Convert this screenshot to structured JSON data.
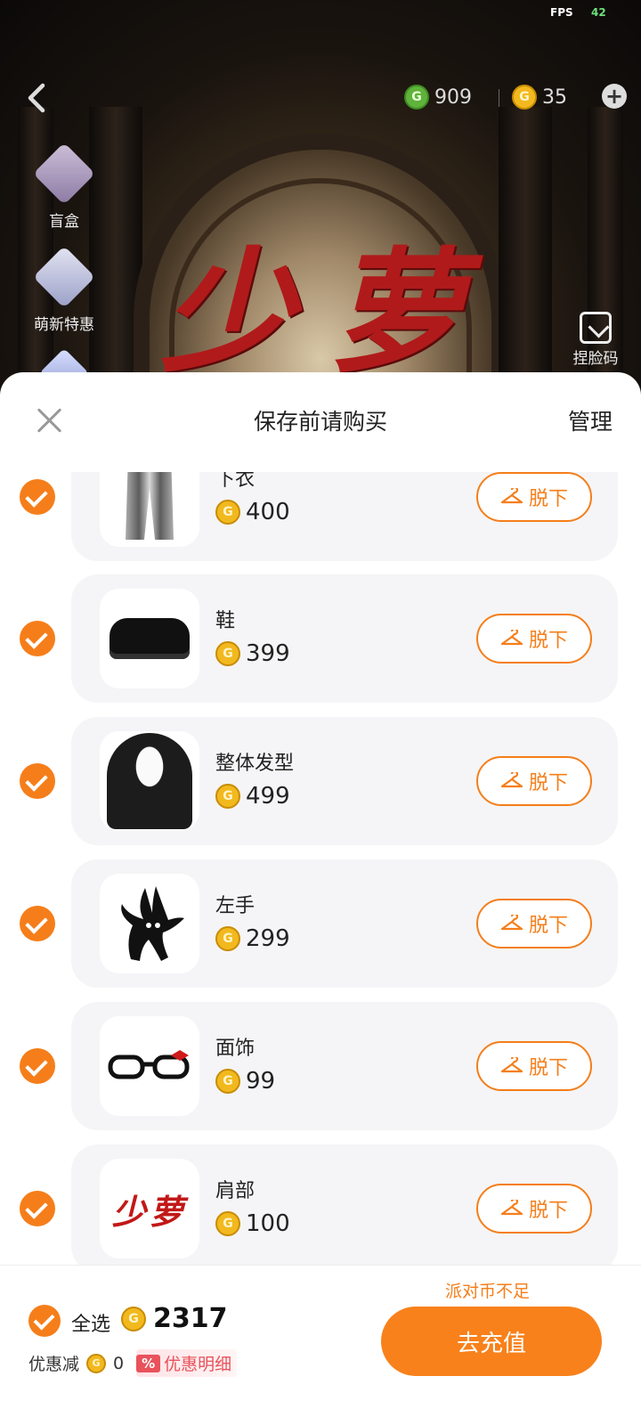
{
  "status_bar": {
    "fps_label": "FPS",
    "fps_value": "42"
  },
  "header": {
    "green_currency": "909",
    "gold_currency": "35"
  },
  "side_menu": [
    {
      "label": "盲盒"
    },
    {
      "label": "萌新特惠"
    }
  ],
  "face_code_label": "捏脸码",
  "scene_brand_text": "少萝",
  "sheet": {
    "title": "保存前请购买",
    "manage_label": "管理"
  },
  "items": [
    {
      "name": "下衣",
      "price": "400",
      "action": "脱下",
      "thumb": "pants-icon",
      "checked": true
    },
    {
      "name": "鞋",
      "price": "399",
      "action": "脱下",
      "thumb": "shoes-icon",
      "checked": true
    },
    {
      "name": "整体发型",
      "price": "499",
      "action": "脱下",
      "thumb": "hairstyle-icon",
      "checked": true
    },
    {
      "name": "左手",
      "price": "299",
      "action": "脱下",
      "thumb": "bunny-plush-icon",
      "checked": true
    },
    {
      "name": "面饰",
      "price": "99",
      "action": "脱下",
      "thumb": "glasses-icon",
      "checked": true
    },
    {
      "name": "肩部",
      "price": "100",
      "action": "脱下",
      "thumb": "shoulder-text-icon",
      "checked": true,
      "thumb_text": "少萝"
    }
  ],
  "footer": {
    "select_all_label": "全选",
    "total": "2317",
    "discount_label": "优惠减",
    "discount_value": "0",
    "discount_tag": "%",
    "discount_detail_label": "优惠明细",
    "insufficient_text": "派对币不足",
    "recharge_label": "去充值"
  },
  "colors": {
    "accent": "#f57e1a",
    "gold_coin": "#f2b91e",
    "green_coin": "#5fb23a",
    "discount_red": "#e8525b",
    "brand_red": "#b11a1a"
  }
}
